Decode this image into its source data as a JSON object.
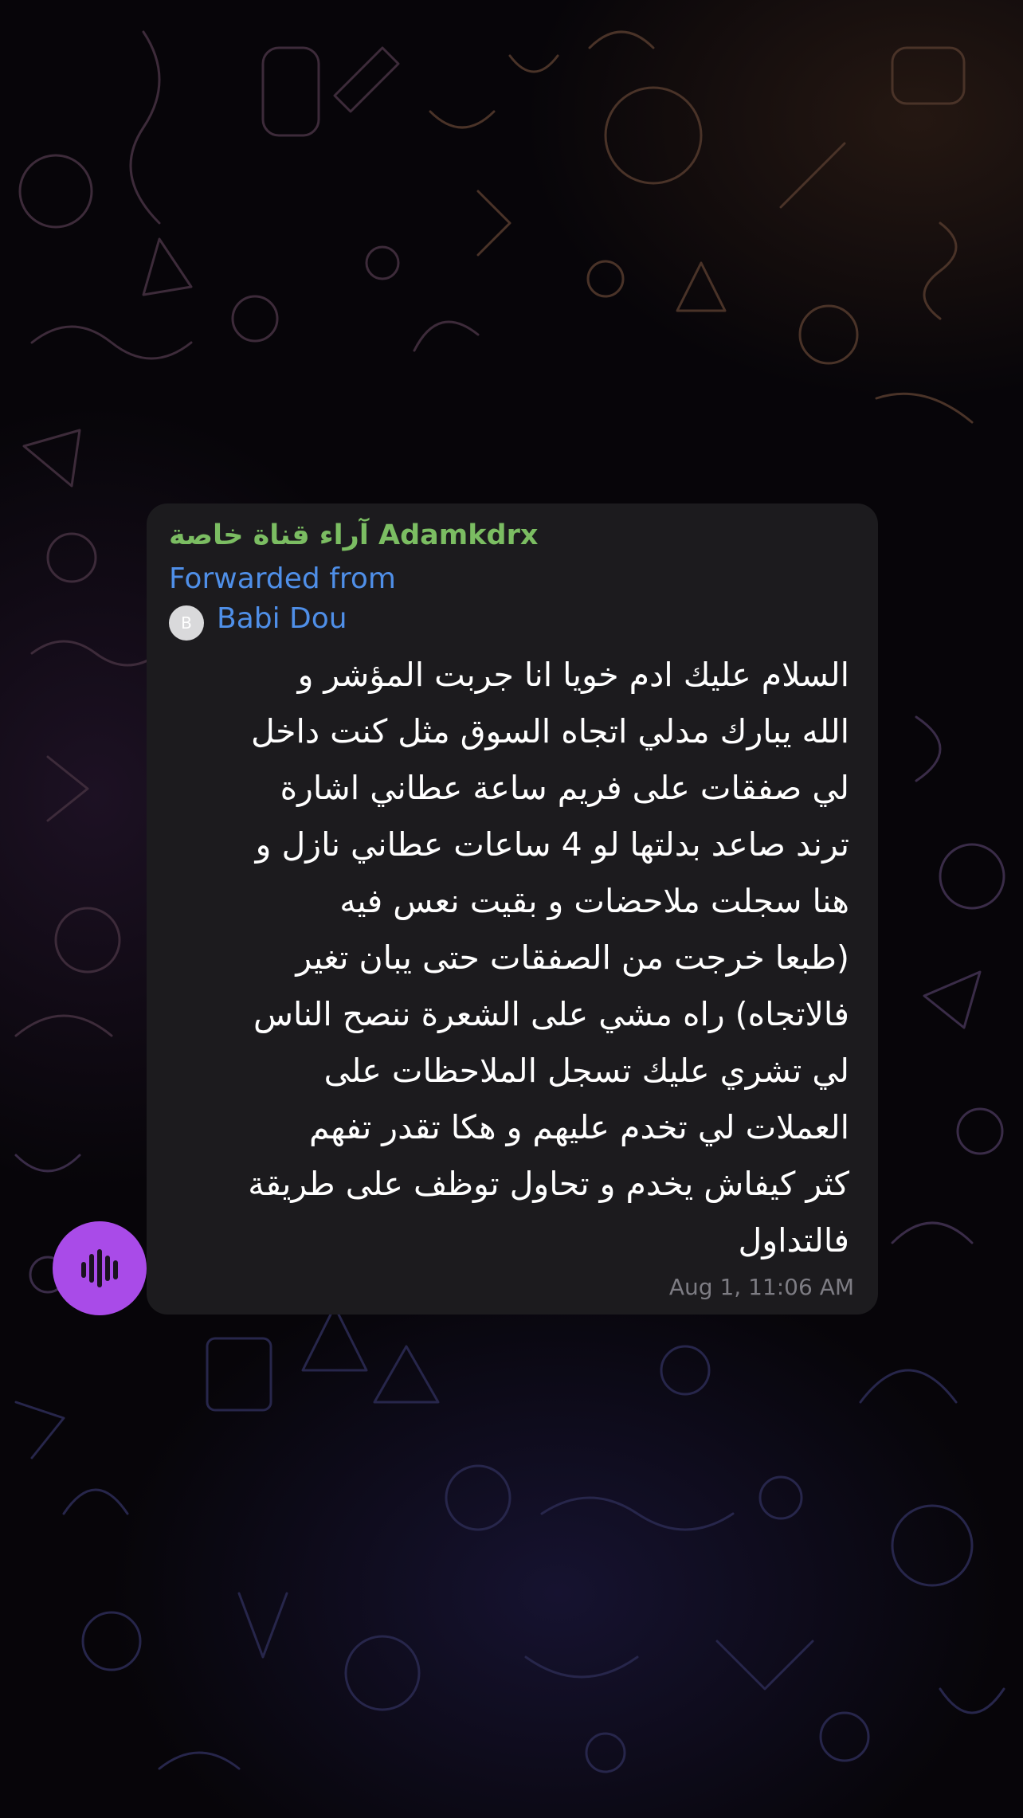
{
  "message": {
    "channel_title": "آراء قناة خاصة Adamkdrx",
    "forward_label": "Forwarded from",
    "forward_avatar_letter": "B",
    "forward_name": "Babi Dou",
    "text": "السلام عليك ادم خويا انا جربت المؤشر و\nالله يبارك مدلي اتجاه السوق مثل كنت داخل\nلي صفقات على فريم ساعة عطاني اشارة\nترند صاعد بدلتها لو 4 ساعات عطاني نازل و\nهنا سجلت  ملاحضات و بقيت نعس فيه\n(طبعا خرجت من الصفقات حتى يبان تغير\nفالاتجاه) راه مشي على الشعرة  ننصح الناس\nلي تشري عليك تسجل الملاحظات على\nالعملات لي تخدم عليهم و هكا تقدر تفهم\nكثر كيفاش يخدم و تحاول توظف على طريقة\nفالتداول",
    "timestamp": "Aug 1, 11:06 AM"
  },
  "sender_avatar": {
    "icon": "sound-wave-icon"
  },
  "colors": {
    "bubble": "#1c1b1e",
    "channel_name": "#7bbd62",
    "forward_link": "#4f8fe8",
    "timestamp": "#7d7c83",
    "avatar": "#a94be8"
  }
}
